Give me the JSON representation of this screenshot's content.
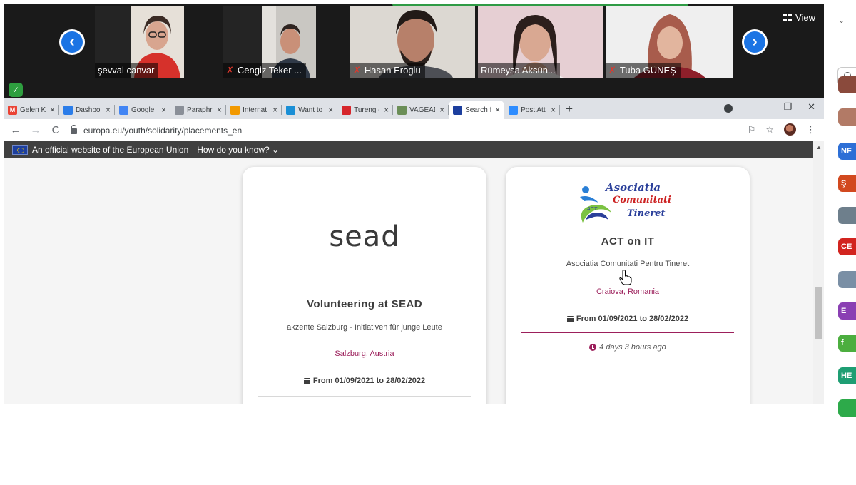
{
  "zoom": {
    "view_label": "View",
    "participants": [
      {
        "name": "şevval canvar",
        "muted": false
      },
      {
        "name": "Cengiz Teker ...",
        "muted": true
      },
      {
        "name": "Hasan Eroglu",
        "muted": true
      },
      {
        "name": "Rümeysa Aksün...",
        "muted": false
      },
      {
        "name": "Tuba GÜNEŞ",
        "muted": true
      }
    ],
    "rail": {
      "avatars": [
        {
          "kind": "photo",
          "color": "#8a4a3c"
        },
        {
          "kind": "photo",
          "color": "#b27a66"
        },
        {
          "kind": "initials",
          "text": "NF",
          "color": "#2d6fd6"
        },
        {
          "kind": "initials",
          "text": "Ş",
          "color": "#d2491f"
        },
        {
          "kind": "photo",
          "color": "#6e7f8c"
        },
        {
          "kind": "initials",
          "text": "CE",
          "color": "#d2241f"
        },
        {
          "kind": "photo",
          "color": "#7a8fa5"
        },
        {
          "kind": "initials",
          "text": "E",
          "color": "#8a3fb3"
        },
        {
          "kind": "initials",
          "text": "f",
          "color": "#4cae3f"
        },
        {
          "kind": "initials",
          "text": "HE",
          "color": "#1e9e73"
        },
        {
          "kind": "initials",
          "text": "",
          "color": "#2daa4a"
        }
      ]
    }
  },
  "browser": {
    "tabs": [
      {
        "label": "Gelen Ku",
        "icon": "gmail-icon",
        "color": "#ea4335",
        "glyph": "M",
        "active": false
      },
      {
        "label": "Dashboa",
        "icon": "dashboard-icon",
        "color": "#2b7de9",
        "glyph": "",
        "active": false
      },
      {
        "label": "Google",
        "icon": "google-docs-icon",
        "color": "#4285f4",
        "glyph": "",
        "active": false
      },
      {
        "label": "Paraphra",
        "icon": "paraphrase-icon",
        "color": "#8a8f98",
        "glyph": "",
        "active": false
      },
      {
        "label": "Internat",
        "icon": "international-icon",
        "color": "#f29900",
        "glyph": "",
        "active": false
      },
      {
        "label": "Want to",
        "icon": "edge-icon",
        "color": "#1a8fd6",
        "glyph": "",
        "active": false
      },
      {
        "label": "Tureng -",
        "icon": "tureng-icon",
        "color": "#d6262b",
        "glyph": "",
        "active": false
      },
      {
        "label": "VAGEAD",
        "icon": "vagead-icon",
        "color": "#6b8e57",
        "glyph": "",
        "active": false
      },
      {
        "label": "Search f",
        "icon": "eu-flag-icon",
        "color": "#1d3f9e",
        "glyph": "",
        "active": true
      },
      {
        "label": "Post Att",
        "icon": "zoom-icon",
        "color": "#2d8cff",
        "glyph": "",
        "active": false
      }
    ],
    "url": "europa.eu/youth/solidarity/placements_en"
  },
  "page": {
    "eu_banner": {
      "official": "An official website of the European Union",
      "how_know": "How do you know?"
    },
    "cards": [
      {
        "logo_text": "sead",
        "title": "Volunteering at SEAD",
        "organisation": "akzente Salzburg - Initiativen für junge Leute",
        "location": "Salzburg, Austria",
        "dates": "From 01/09/2021 to 28/02/2022",
        "rule_color": "#d8d8d8"
      },
      {
        "logo_lines": [
          "Asociatia",
          "Comunitati",
          "Tineret"
        ],
        "logo_badge": "ACT",
        "title": "ACT on IT",
        "organisation": "Asociatia Comunitati Pentru Tineret",
        "location": "Craiova, Romania",
        "dates": "From 01/09/2021 to 28/02/2022",
        "posted": "4 days 3 hours ago",
        "rule_color": "#9c1f5b"
      }
    ]
  }
}
